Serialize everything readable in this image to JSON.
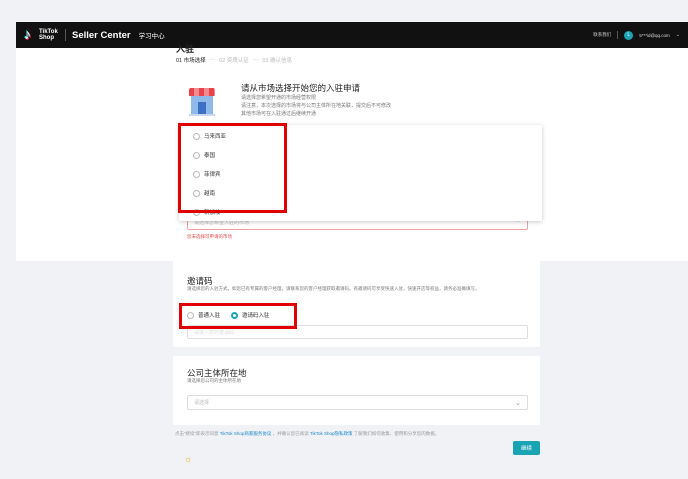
{
  "header": {
    "logo_text": "TikTok Shop",
    "title": "Seller Center",
    "nav_learn": "学习中心",
    "contact": "联系我们",
    "avatar_letter": "L",
    "user_email": "5***id@qq.com",
    "caret": "⌄"
  },
  "page": {
    "title_fragment": "入驻",
    "steps": [
      "01 市场选择",
      "02 资质认证",
      "03 确认信息"
    ],
    "step_separator": "---"
  },
  "market_card": {
    "heading": "请从市场选择开始您的入驻申请",
    "notes": [
      "请选择您希望开通的市场经营权限",
      "请注意，本次选择的市场将与公司主体所在地关联，提交后不可修改",
      "其他市场可在入驻通过后继续开通"
    ],
    "options": [
      "马来西亚",
      "泰国",
      "菲律宾",
      "越南",
      "新加坡"
    ],
    "select_placeholder": "请选择您希望入驻的市场",
    "chevron": "⌃",
    "error_text": "您未选择可申请的市场"
  },
  "invite_card": {
    "title": "邀请码",
    "description": "请选择您的入驻方式。如您已有专属的客户经理，请联系您的客户经理获取邀请码。有邀请码可享受快速入驻，快速开店等权益，请务必准确填写。",
    "options": [
      {
        "label": "普通入驻",
        "checked": false
      },
      {
        "label": "邀请码入驻",
        "checked": true
      }
    ],
    "input_placeholder": "请输入您的邀请码"
  },
  "company_card": {
    "title": "公司主体所在地",
    "description": "请选择您公司的主体所在地",
    "select_placeholder": "请选择",
    "chevron": "⌄"
  },
  "footer": {
    "agreement_prefix": "点击“继续”即表示同意",
    "link1": "TikTok Shop商家服务协议",
    "agreement_middle": "，并确认您已阅读",
    "link2": "TikTok Shop隐私政策",
    "agreement_suffix": "了解我们如何收集、使用和分享您的数据。",
    "next_button": "继续",
    "sun_glyph": "☼"
  },
  "colors": {
    "accent": "#1aa3b5",
    "error": "#e84848",
    "highlight": "#e00000",
    "topbar": "#111111"
  }
}
